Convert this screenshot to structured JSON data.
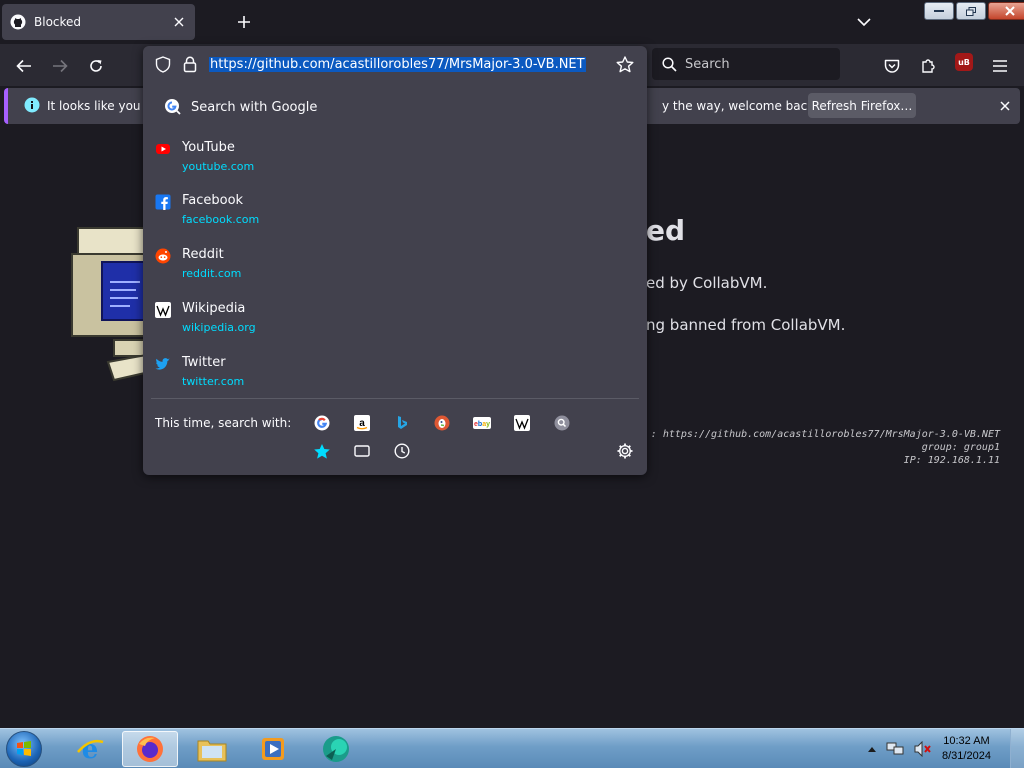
{
  "tab": {
    "title": "Blocked"
  },
  "address_bar": {
    "url": "https://github.com/acastillorobles77/MrsMajor-3.0-VB.NET"
  },
  "search_box": {
    "placeholder": "Search"
  },
  "extension": {
    "ublock_label": "uB"
  },
  "notification": {
    "text_left": "It looks like you ha",
    "text_right": "y the way, welcome back!",
    "button_label": "Refresh Firefox…"
  },
  "dropdown": {
    "search_with_google": "Search with Google",
    "sites": [
      {
        "name": "YouTube",
        "domain": "youtube.com",
        "icon": "youtube-icon",
        "color": "#ff0000"
      },
      {
        "name": "Facebook",
        "domain": "facebook.com",
        "icon": "facebook-icon",
        "color": "#1877f2"
      },
      {
        "name": "Reddit",
        "domain": "reddit.com",
        "icon": "reddit-icon",
        "color": "#ff4500"
      },
      {
        "name": "Wikipedia",
        "domain": "wikipedia.org",
        "icon": "wikipedia-icon",
        "color": "#ffffff"
      },
      {
        "name": "Twitter",
        "domain": "twitter.com",
        "icon": "twitter-icon",
        "color": "#1da1f2"
      }
    ],
    "this_time_label": "This time, search with:",
    "engines": [
      "google-icon",
      "amazon-icon",
      "bing-icon",
      "duckduckgo-icon",
      "ebay-icon",
      "wikipedia-icon",
      "search-icon"
    ],
    "modes": [
      "bookmarks-star-icon",
      "tabs-icon",
      "history-clock-icon"
    ]
  },
  "page": {
    "title_fragment": "ed",
    "line1": "ed by CollabVM.",
    "line2": "ng banned from CollabVM.",
    "info_url": ": https://github.com/acastillorobles77/MrsMajor-3.0-VB.NET",
    "info_group": "group: group1",
    "info_ip": "IP: 192.168.1.11"
  },
  "taskbar": {
    "time": "10:32 AM",
    "date": "8/31/2024"
  },
  "colors": {
    "accent": "#00ddff",
    "highlight": "#0b59c0",
    "panel": "#42414d",
    "background": "#1c1b22"
  }
}
